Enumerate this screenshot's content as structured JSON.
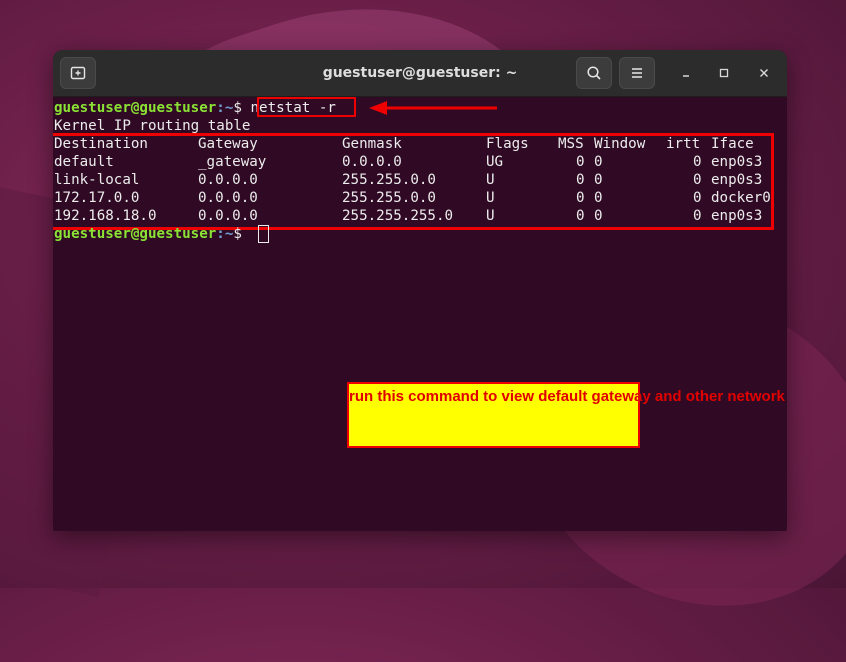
{
  "window": {
    "title": "guestuser@guestuser: ~"
  },
  "terminal": {
    "prompt_user": "guestuser@guestuser",
    "prompt_path": ":~",
    "prompt_symbol": "$ ",
    "command": "netstat -r",
    "heading": "Kernel IP routing table",
    "columns": [
      "Destination",
      "Gateway",
      "Genmask",
      "Flags",
      "MSS",
      "Window",
      "irtt",
      "Iface"
    ],
    "rows": [
      [
        "default",
        "_gateway",
        "0.0.0.0",
        "UG",
        "0",
        "0",
        "0",
        "enp0s3"
      ],
      [
        "link-local",
        "0.0.0.0",
        "255.255.0.0",
        "U",
        "0",
        "0",
        "0",
        "enp0s3"
      ],
      [
        "172.17.0.0",
        "0.0.0.0",
        "255.255.0.0",
        "U",
        "0",
        "0",
        "0",
        "docker0"
      ],
      [
        "192.168.18.0",
        "0.0.0.0",
        "255.255.255.0",
        "U",
        "0",
        "0",
        "0",
        "enp0s3"
      ]
    ]
  },
  "annotation": {
    "text": "run this command to view default gateway and other network related info"
  },
  "colors": {
    "terminal_bg": "#300a24",
    "prompt_user": "#8ae234",
    "prompt_path": "#729fcf",
    "highlight": "#e00000",
    "callout_bg": "#ffff00"
  },
  "icons": [
    "new-tab-icon",
    "search-icon",
    "hamburger-menu-icon",
    "minimize-icon",
    "maximize-icon",
    "close-icon"
  ]
}
